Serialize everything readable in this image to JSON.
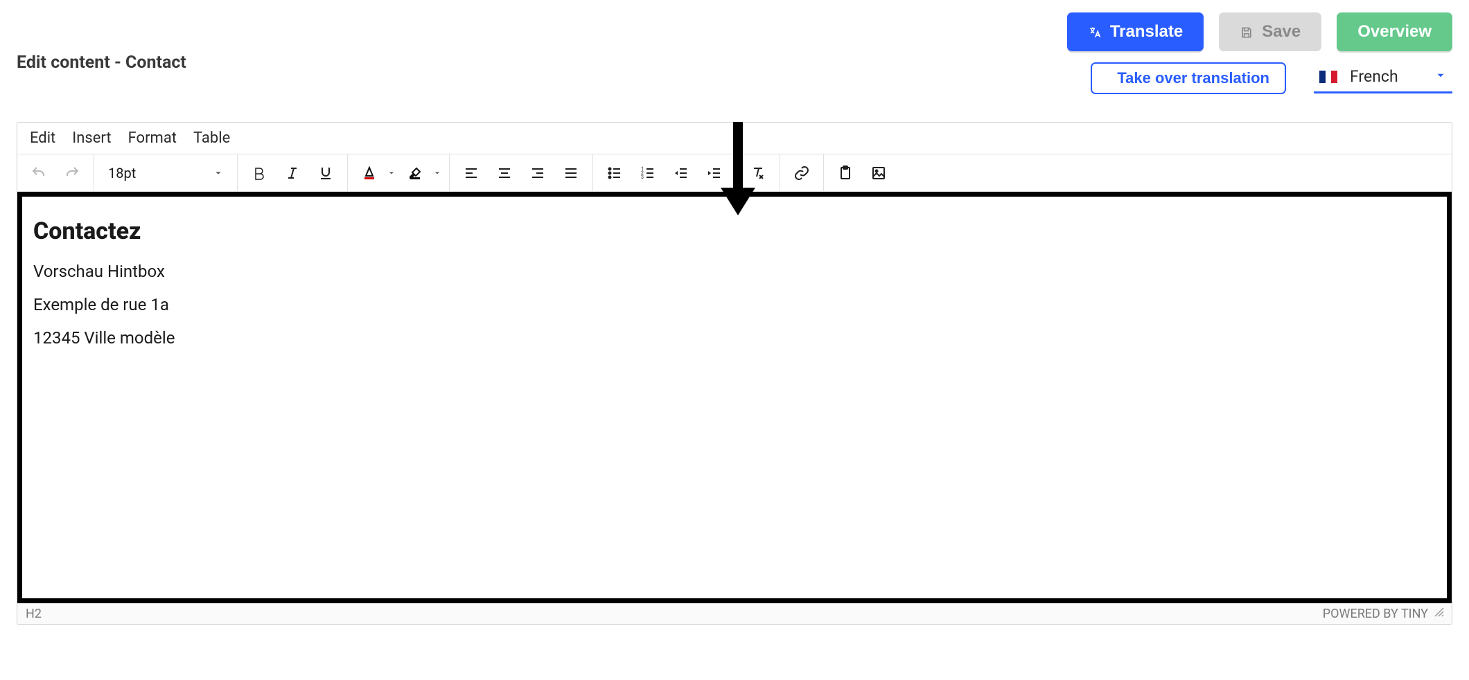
{
  "header": {
    "title": "Edit content - Contact",
    "translate_label": "Translate",
    "save_label": "Save",
    "overview_label": "Overview",
    "take_over_label": "Take over translation",
    "language": "French"
  },
  "editor": {
    "menu": {
      "edit": "Edit",
      "insert": "Insert",
      "format": "Format",
      "table": "Table"
    },
    "font_size": "18pt",
    "status_path": "H2",
    "powered_by": "POWERED BY TINY"
  },
  "content": {
    "heading": "Contactez",
    "p1": "Vorschau Hintbox",
    "p2": "Exemple de rue 1a",
    "p3": "12345 Ville modèle"
  }
}
